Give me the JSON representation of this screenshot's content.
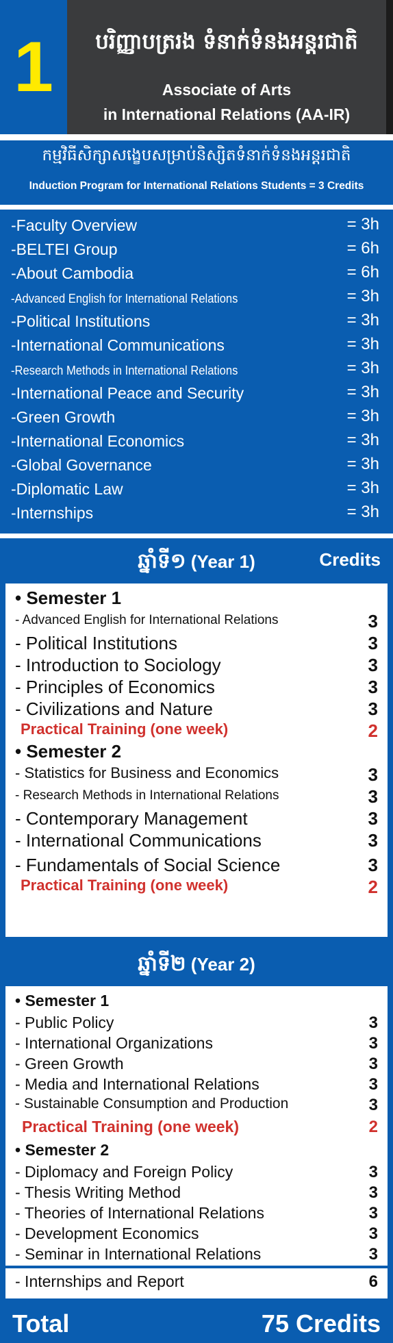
{
  "header": {
    "number": "1",
    "title_kh": "បរិញ្ញាបត្ររង ទំនាក់ទំនងអន្តរជាតិ",
    "title_en_line1": "Associate of Arts",
    "title_en_line2": "in International Relations (AA-IR)"
  },
  "induction": {
    "title_kh": "កម្មវិធីសិក្សាសង្ខេបសម្រាប់និស្សិតទំនាក់ទំនងអន្តរជាតិ",
    "title_en": "Induction Program for International Relations Students = 3 Credits",
    "items": [
      {
        "name": "-Faculty Overview",
        "hours": "= 3h"
      },
      {
        "name": "-BELTEI Group",
        "hours": "= 6h"
      },
      {
        "name": "-About Cambodia",
        "hours": "= 6h"
      },
      {
        "name": "-Advanced English for International Relations",
        "hours": "= 3h"
      },
      {
        "name": "-Political Institutions",
        "hours": "= 3h"
      },
      {
        "name": "-International Communications",
        "hours": "= 3h"
      },
      {
        "name": "-Research Methods in International Relations",
        "hours": "= 3h"
      },
      {
        "name": "-International Peace and Security",
        "hours": "= 3h"
      },
      {
        "name": "-Green Growth",
        "hours": "= 3h"
      },
      {
        "name": "-International Economics",
        "hours": "= 3h"
      },
      {
        "name": "-Global Governance",
        "hours": "= 3h"
      },
      {
        "name": "-Diplomatic Law",
        "hours": "= 3h"
      },
      {
        "name": "-Internships",
        "hours": "= 3h"
      }
    ]
  },
  "year1": {
    "title_kh": "ឆ្នាំទី១",
    "title_en": "(Year 1)",
    "credits_label": "Credits",
    "sem1_label": "• Semester 1",
    "sem1": [
      {
        "name": "- Advanced English for International Relations",
        "credits": "3"
      },
      {
        "name": "- Political Institutions",
        "credits": "3"
      },
      {
        "name": "- Introduction to Sociology",
        "credits": "3"
      },
      {
        "name": "- Principles of Economics",
        "credits": "3"
      },
      {
        "name": "- Civilizations and Nature",
        "credits": "3"
      }
    ],
    "sem1_practical": {
      "name": "Practical Training (one week)",
      "credits": "2"
    },
    "sem2_label": "• Semester 2",
    "sem2": [
      {
        "name": "- Statistics for Business and Economics",
        "credits": "3"
      },
      {
        "name": "- Research Methods in International Relations",
        "credits": "3"
      },
      {
        "name": "- Contemporary Management",
        "credits": "3"
      },
      {
        "name": "- International Communications",
        "credits": "3"
      },
      {
        "name": "- Fundamentals of Social Science",
        "credits": "3"
      }
    ],
    "sem2_practical": {
      "name": "Practical Training (one week)",
      "credits": "2"
    }
  },
  "year2": {
    "title_kh": "ឆ្នាំទី២",
    "title_en": "(Year 2)",
    "sem1_label": "• Semester 1",
    "sem1": [
      {
        "name": "- Public Policy",
        "credits": "3"
      },
      {
        "name": "- International Organizations",
        "credits": "3"
      },
      {
        "name": "- Green Growth",
        "credits": "3"
      },
      {
        "name": "- Media and International Relations",
        "credits": "3"
      },
      {
        "name": "- Sustainable Consumption and Production",
        "credits": "3"
      }
    ],
    "sem1_practical": {
      "name": "Practical Training (one week)",
      "credits": "2"
    },
    "sem2_label": "• Semester 2",
    "sem2": [
      {
        "name": "- Diplomacy and Foreign Policy",
        "credits": "3"
      },
      {
        "name": "- Thesis Writing Method",
        "credits": "3"
      },
      {
        "name": "- Theories of International Relations",
        "credits": "3"
      },
      {
        "name": "- Development Economics",
        "credits": "3"
      },
      {
        "name": "- Seminar in International Relations",
        "credits": "3"
      }
    ],
    "internships": {
      "name": "- Internships and Report",
      "credits": "6"
    }
  },
  "total": {
    "label": "Total",
    "value": "75 Credits"
  }
}
